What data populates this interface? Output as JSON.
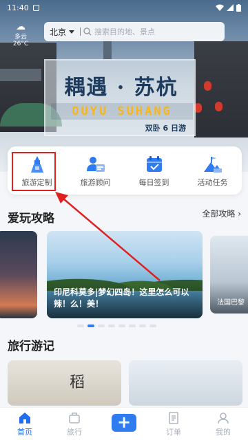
{
  "status": {
    "time": "11:40"
  },
  "header": {
    "weather": "多云 26°C",
    "city": "北京",
    "search_placeholder": "搜索目的地、景点"
  },
  "banner": {
    "title": "耦遇 · 苏杭",
    "subtitle": "OUYU SUHANG",
    "note": "双卧 6 日游"
  },
  "services": [
    {
      "label": "旅游定制",
      "icon": "tour-custom-icon"
    },
    {
      "label": "旅游顾问",
      "icon": "advisor-icon"
    },
    {
      "label": "每日签到",
      "icon": "calendar-checkin-icon"
    },
    {
      "label": "活动任务",
      "icon": "mountain-flag-icon"
    }
  ],
  "guides": {
    "title": "爱玩攻略",
    "more": "全部攻略",
    "cards": [
      {
        "caption": ""
      },
      {
        "caption": "印尼科莫多|梦幻四岛！这里怎么可以辣！么！美！"
      },
      {
        "caption": "法国巴黎"
      }
    ],
    "dots": 8,
    "active_dot": 1
  },
  "travel_notes": {
    "title": "旅行游记",
    "calligraphy": "稻"
  },
  "tabbar": {
    "items": [
      {
        "label": "首页",
        "active": true
      },
      {
        "label": "旅行",
        "active": false
      },
      {
        "label": "+",
        "active": false
      },
      {
        "label": "订单",
        "active": false
      },
      {
        "label": "我的",
        "active": false
      }
    ]
  },
  "colors": {
    "accent": "#2f7bf0",
    "highlight": "#e02020"
  }
}
